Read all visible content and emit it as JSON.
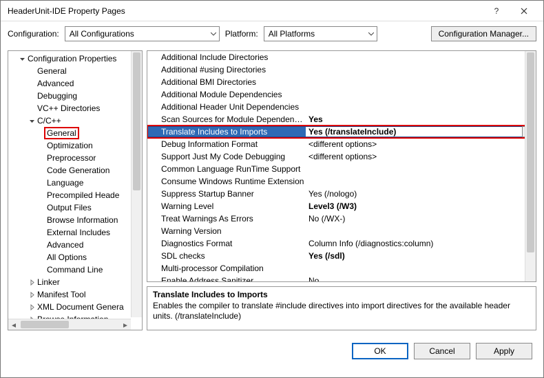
{
  "window": {
    "title": "HeaderUnit-IDE Property Pages"
  },
  "config": {
    "label": "Configuration:",
    "value": "All Configurations",
    "platform_label": "Platform:",
    "platform_value": "All Platforms",
    "manager_label": "Configuration Manager..."
  },
  "tree": {
    "root_label": "Configuration Properties",
    "items": [
      {
        "label": "General"
      },
      {
        "label": "Advanced"
      },
      {
        "label": "Debugging"
      },
      {
        "label": "VC++ Directories"
      }
    ],
    "ccpp_label": "C/C++",
    "ccpp_items": [
      {
        "label": "General",
        "highlight": true
      },
      {
        "label": "Optimization"
      },
      {
        "label": "Preprocessor"
      },
      {
        "label": "Code Generation"
      },
      {
        "label": "Language"
      },
      {
        "label": "Precompiled Heade"
      },
      {
        "label": "Output Files"
      },
      {
        "label": "Browse Information"
      },
      {
        "label": "External Includes"
      },
      {
        "label": "Advanced"
      },
      {
        "label": "All Options"
      },
      {
        "label": "Command Line"
      }
    ],
    "trailing": [
      {
        "label": "Linker",
        "expandable": true
      },
      {
        "label": "Manifest Tool",
        "expandable": true
      },
      {
        "label": "XML Document Genera",
        "expandable": true
      },
      {
        "label": "Browse Information",
        "expandable": true
      }
    ]
  },
  "properties": [
    {
      "name": "Additional Include Directories",
      "value": ""
    },
    {
      "name": "Additional #using Directories",
      "value": ""
    },
    {
      "name": "Additional BMI Directories",
      "value": ""
    },
    {
      "name": "Additional Module Dependencies",
      "value": ""
    },
    {
      "name": "Additional Header Unit Dependencies",
      "value": ""
    },
    {
      "name": "Scan Sources for Module Dependencies",
      "value": "Yes",
      "bold": true
    },
    {
      "name": "Translate Includes to Imports",
      "value": "Yes (/translateInclude)",
      "bold": true,
      "selected": true
    },
    {
      "name": "Debug Information Format",
      "value": "<different options>"
    },
    {
      "name": "Support Just My Code Debugging",
      "value": "<different options>"
    },
    {
      "name": "Common Language RunTime Support",
      "value": ""
    },
    {
      "name": "Consume Windows Runtime Extension",
      "value": ""
    },
    {
      "name": "Suppress Startup Banner",
      "value": "Yes (/nologo)"
    },
    {
      "name": "Warning Level",
      "value": "Level3 (/W3)",
      "bold": true
    },
    {
      "name": "Treat Warnings As Errors",
      "value": "No (/WX-)"
    },
    {
      "name": "Warning Version",
      "value": ""
    },
    {
      "name": "Diagnostics Format",
      "value": "Column Info (/diagnostics:column)"
    },
    {
      "name": "SDL checks",
      "value": "Yes (/sdl)",
      "bold": true
    },
    {
      "name": "Multi-processor Compilation",
      "value": ""
    },
    {
      "name": "Enable Address Sanitizer",
      "value": "No"
    }
  ],
  "description": {
    "title": "Translate Includes to Imports",
    "text": "Enables the compiler to translate #include directives into import directives for the available header units. (/translateInclude)"
  },
  "footer": {
    "ok": "OK",
    "cancel": "Cancel",
    "apply": "Apply"
  }
}
